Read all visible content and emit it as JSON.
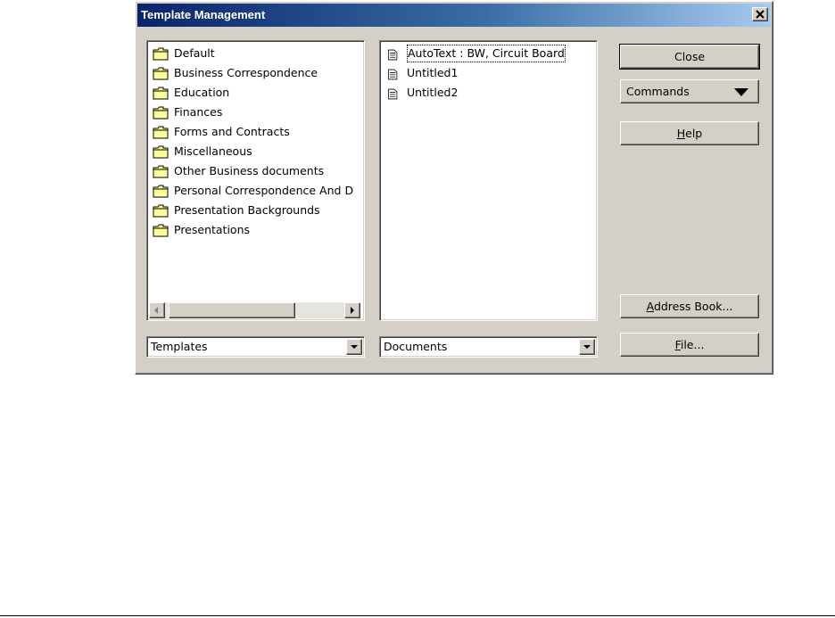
{
  "dialog": {
    "title": "Template Management",
    "close_glyph": "×"
  },
  "left_panel": {
    "items": [
      {
        "label": "Default",
        "icon": "folder-icon"
      },
      {
        "label": "Business Correspondence",
        "icon": "folder-icon"
      },
      {
        "label": "Education",
        "icon": "folder-icon"
      },
      {
        "label": "Finances",
        "icon": "folder-icon"
      },
      {
        "label": "Forms and Contracts",
        "icon": "folder-icon"
      },
      {
        "label": "Miscellaneous",
        "icon": "folder-icon"
      },
      {
        "label": "Other Business documents",
        "icon": "folder-icon"
      },
      {
        "label": "Personal Correspondence And D",
        "icon": "folder-icon"
      },
      {
        "label": "Presentation Backgrounds",
        "icon": "folder-icon"
      },
      {
        "label": "Presentations",
        "icon": "folder-icon"
      }
    ],
    "combo_value": "Templates"
  },
  "middle_panel": {
    "items": [
      {
        "label": "AutoText : BW, Circuit Board",
        "icon": "document-icon",
        "focused": true
      },
      {
        "label": "Untitled1",
        "icon": "document-icon"
      },
      {
        "label": "Untitled2",
        "icon": "document-icon"
      }
    ],
    "combo_value": "Documents"
  },
  "buttons": {
    "close_label": "Close",
    "commands_label": "Commands",
    "help_mnemonic": "H",
    "help_rest": "elp",
    "address_mnemonic": "A",
    "address_rest": "ddress Book...",
    "file_mnemonic": "F",
    "file_rest": "ile..."
  },
  "colors": {
    "titlebar_start": "#0a246a",
    "titlebar_end": "#a6caf0",
    "face": "#d4d0c8"
  }
}
